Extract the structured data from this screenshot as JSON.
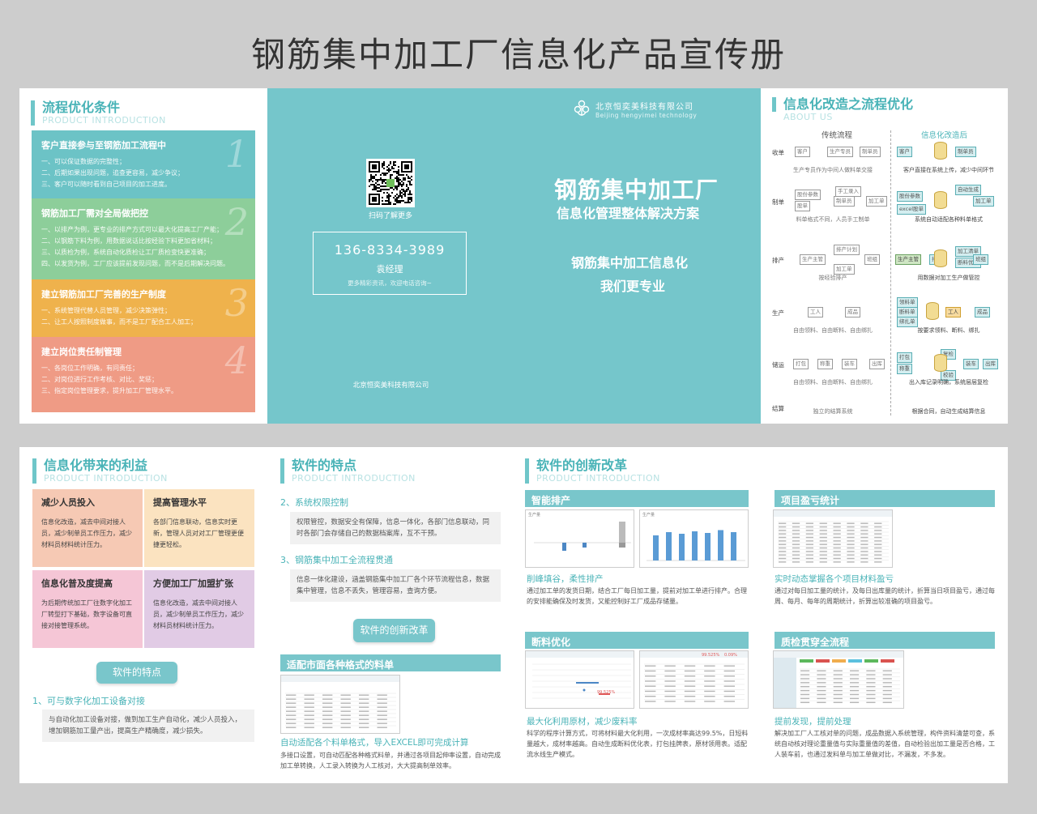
{
  "title": "钢筋集中加工厂信息化产品宣传册",
  "left_panel": {
    "heading": "流程优化条件",
    "subheading": "PRODUCT INTRODUCTION",
    "blocks": [
      {
        "num": "1",
        "title": "客户直接参与至钢筋加工流程中",
        "color": "#6cc3c6",
        "lines": [
          "一、可以保证数据的完整性；",
          "二、后期如果出现问题，追查更容易，减少争议；",
          "三、客户可以随时看到自己项目的加工进度。"
        ]
      },
      {
        "num": "2",
        "title": "钢筋加工厂需对全局做把控",
        "color": "#8dce9a",
        "lines": [
          "一、以排产为例，更专业的排产方式可以最大化提高工厂产能；",
          "二、以钢筋下料为例，用数据说话比按经验下料更加省材料；",
          "三、以质检为例，系统自动化质检让工厂质检变快更准确；",
          "四、以发货为例，工厂应该提前发现问题，而不是后期解决问题。"
        ]
      },
      {
        "num": "3",
        "title": "建立钢筋加工厂完善的生产制度",
        "color": "#efb24c",
        "lines": [
          "一、系统管理代替人员管理，减少决策弹性；",
          "二、让工人按照制度做事，而不是工厂配合工人加工；"
        ]
      },
      {
        "num": "4",
        "title": "建立岗位责任制管理",
        "color": "#ef9b85",
        "lines": [
          "一、各岗位工作明确，有问责任；",
          "二、对岗位进行工作考核、对比、奖惩；",
          "三、指定岗位管理要求，提升加工厂管理水平。"
        ]
      }
    ]
  },
  "cover": {
    "company_cn": "北京恒奕美科技有限公司",
    "company_en": "Beijing hengyimei technology",
    "qr_caption": "扫码了解更多",
    "phone": "136-8334-3989",
    "contact": "袁经理",
    "contact_note": "更多精彩资讯，欢迎电话咨询~",
    "footer": "北京恒奕美科技有限公司",
    "main_title": "钢筋集中加工厂",
    "main_sub": "信息化管理整体解决方案",
    "slogan1": "钢筋集中加工信息化",
    "slogan2": "我们更专业"
  },
  "right_panel": {
    "heading": "信息化改造之流程优化",
    "subheading": "ABOUT US",
    "col_traditional": "传统流程",
    "col_after": "信息化改造后",
    "rows": [
      {
        "label": "收单",
        "trad_note": "生产专员作为中间人做料单交接",
        "after_note": "客户直接在系统上传，减少中间环节",
        "trad_boxes": [
          "客户",
          "生产专员",
          "制单员"
        ],
        "after_boxes": [
          "客户",
          "制单员"
        ]
      },
      {
        "label": "制单",
        "trad_note": "料单格式不同，人员手工制单",
        "after_note": "系统自动适配各种料单格式",
        "trad_boxes": [
          "股份参数",
          "股单",
          "制单员",
          "手工录入",
          "加工单"
        ],
        "after_boxes": [
          "股份参数",
          "excel股单",
          "自动生成",
          "加工单"
        ]
      },
      {
        "label": "排产",
        "trad_note": "按经验排产",
        "after_note": "用数据对加工生产做管控",
        "trad_boxes": [
          "生产主管",
          "排产计划",
          "加工单",
          "班组"
        ],
        "after_boxes": [
          "生产主管",
          "加工清单",
          "断料优化",
          "排产",
          "班组"
        ]
      },
      {
        "label": "生产",
        "trad_note": "自由领料、自由断料、自由绑扎",
        "after_note": "按要求领料、断料、绑扎",
        "trad_boxes": [
          "工人",
          "成品"
        ],
        "after_boxes": [
          "领料单",
          "断料单",
          "绑扎单",
          "工人",
          "成品"
        ]
      },
      {
        "label": "储运",
        "trad_note": "自由领料、自由断料、自由绑扎",
        "after_note": "出入库记录明确，系统层层复检",
        "trad_boxes": [
          "打包",
          "称重",
          "装车",
          "出库"
        ],
        "after_boxes": [
          "打包",
          "称重",
          "复检",
          "装车",
          "出库",
          "校验"
        ]
      },
      {
        "label": "结算",
        "trad_note": "独立的结算系统",
        "after_note": "根据合同，自动生成结算信息",
        "trad_boxes": [],
        "after_boxes": []
      }
    ]
  },
  "benefits": {
    "heading": "信息化带来的利益",
    "subheading": "PRODUCT INTRODUCTION",
    "cards": [
      {
        "title": "减少人员投入",
        "text": "信息化改造，减去中间对接人员，减少制单员工作压力，减少材料员材料统计压力。",
        "color": "#f6c9b4"
      },
      {
        "title": "提高管理水平",
        "text": "各部门信息联动，信息实时更新，管理人员对对工厂管理更便捷更轻松。",
        "color": "#fbe3c0"
      },
      {
        "title": "信息化普及度提高",
        "text": "为后期传统加工厂往数字化加工厂转型打下基础，数字设备可直接对接管理系统。",
        "color": "#f5c6d6"
      },
      {
        "title": "方便加工厂加盟扩张",
        "text": "信息化改造，减去中间对接人员，减少制单员工作压力，减少材料员材料统计压力。",
        "color": "#e1cbe5"
      }
    ],
    "button": "软件的特点",
    "feature1_title": "1、可与数字化加工设备对接",
    "feature1_text": "与自动化加工设备对接，做到加工生产自动化，减少人员投入，增加钢筋加工量产出，提高生产精确度，减少损失。"
  },
  "features": {
    "heading": "软件的特点",
    "subheading": "PRODUCT INTRODUCTION",
    "f2_title": "2、系统权限控制",
    "f2_text": "权限管控，数据安全有保障，信息一体化，各部门信息联动，同时各部门会存储自己的数据档案库，互不干预。",
    "f3_title": "3、钢筋集中加工全流程贯通",
    "f3_text": "信息一体化建设，涵盖钢筋集中加工厂各个环节流程信息，数据集中管理，信息不丢失，管理容易，查询方便。",
    "button": "软件的创新改革",
    "bar": "适配市面各种格式的料单",
    "cap_title": "自动适配各个料单格式，导入EXCEL即可完成计算",
    "cap_text": "多接口设置，可自动匹配各种格式料单，并通过各项目起伸率设置，自动完成加工单转换，人工录入转换为人工核对，大大提高制单效率。"
  },
  "innovation": {
    "heading": "软件的创新改革",
    "subheading": "PRODUCT INTRODUCTION",
    "items": [
      {
        "bar": "智能排产",
        "cap_title": "削峰填谷，柔性排产",
        "cap_text": "通过加工单的发货日期，结合工厂每日加工量，提前对加工单进行排产。合理的安排能确保及时发货，又能控制好工厂成品存储量。"
      },
      {
        "bar": "项目盈亏统计",
        "cap_title": "实时动态掌握各个项目材料盈亏",
        "cap_text": "通过对每日加工量的统计，及每日出库量的统计，折算当日项目盈亏，通过每周、每月、每年的周期统计，折算出较准确的项目盈亏。"
      },
      {
        "bar": "断料优化",
        "cap_title": "最大化利用原材，减少废料率",
        "cap_text": "科学的程序计算方式，可将材料最大化利用，一次成材率高达99.5%，日短料量越大，成材率越高。自动生成断料优化表，打包挂牌表，原材领用表。适配流水线生产模式。"
      },
      {
        "bar": "质检贯穿全流程",
        "cap_title": "提前发现，提前处理",
        "cap_text": "解决加工厂人工核对单的问题，成品数据入系统管理，构件资料清楚可查，系统自动核对理论重量值与实际重量值的差值，自动检验出加工量是否合格，工人装车前，也通过发料单与加工单做对比，不漏发，不多发。"
      }
    ],
    "chart1_label": "生产量",
    "chart2_label": "生产量",
    "opt_value1": "99.525%",
    "opt_value2": "0.09%"
  }
}
